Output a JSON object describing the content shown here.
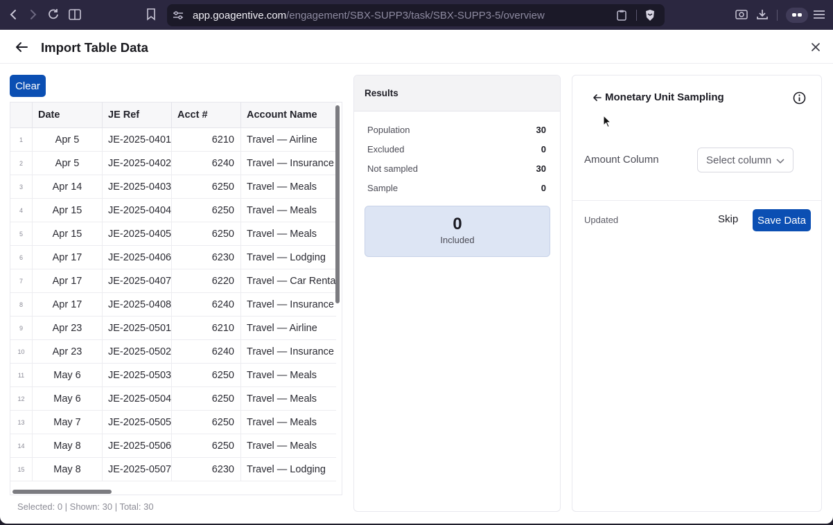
{
  "browser": {
    "url_host": "app.goagentive.com",
    "url_path": "/engagement/SBX-SUPP3/task/SBX-SUPP3-5/overview",
    "icons": [
      "back-icon",
      "forward-icon",
      "reload-icon",
      "sidebar-icon",
      "bookmark-icon",
      "site-settings-icon",
      "clipboard-icon",
      "brave-shield-icon",
      "screenshot-icon",
      "download-icon",
      "wallet-icon",
      "menu-icon"
    ]
  },
  "header": {
    "title": "Import Table Data"
  },
  "toolbar": {
    "clear_label": "Clear"
  },
  "table": {
    "columns": [
      "Date",
      "JE Ref",
      "Acct #",
      "Account Name"
    ],
    "rows": [
      {
        "n": "1",
        "date": "Apr 5",
        "ref": "JE-2025-0401",
        "acct": "6210",
        "name": "Travel — Airline"
      },
      {
        "n": "2",
        "date": "Apr 5",
        "ref": "JE-2025-0402",
        "acct": "6240",
        "name": "Travel — Insurance"
      },
      {
        "n": "3",
        "date": "Apr 14",
        "ref": "JE-2025-0403",
        "acct": "6250",
        "name": "Travel — Meals"
      },
      {
        "n": "4",
        "date": "Apr 15",
        "ref": "JE-2025-0404",
        "acct": "6250",
        "name": "Travel — Meals"
      },
      {
        "n": "5",
        "date": "Apr 15",
        "ref": "JE-2025-0405",
        "acct": "6250",
        "name": "Travel — Meals"
      },
      {
        "n": "6",
        "date": "Apr 17",
        "ref": "JE-2025-0406",
        "acct": "6230",
        "name": "Travel — Lodging"
      },
      {
        "n": "7",
        "date": "Apr 17",
        "ref": "JE-2025-0407",
        "acct": "6220",
        "name": "Travel — Car Rental"
      },
      {
        "n": "8",
        "date": "Apr 17",
        "ref": "JE-2025-0408",
        "acct": "6240",
        "name": "Travel — Insurance"
      },
      {
        "n": "9",
        "date": "Apr 23",
        "ref": "JE-2025-0501",
        "acct": "6210",
        "name": "Travel — Airline"
      },
      {
        "n": "10",
        "date": "Apr 23",
        "ref": "JE-2025-0502",
        "acct": "6240",
        "name": "Travel — Insurance"
      },
      {
        "n": "11",
        "date": "May 6",
        "ref": "JE-2025-0503",
        "acct": "6250",
        "name": "Travel — Meals"
      },
      {
        "n": "12",
        "date": "May 6",
        "ref": "JE-2025-0504",
        "acct": "6250",
        "name": "Travel — Meals"
      },
      {
        "n": "13",
        "date": "May 7",
        "ref": "JE-2025-0505",
        "acct": "6250",
        "name": "Travel — Meals"
      },
      {
        "n": "14",
        "date": "May 8",
        "ref": "JE-2025-0506",
        "acct": "6250",
        "name": "Travel — Meals"
      },
      {
        "n": "15",
        "date": "May 8",
        "ref": "JE-2025-0507",
        "acct": "6230",
        "name": "Travel — Lodging"
      }
    ],
    "status": "Selected: 0 | Shown: 30 | Total: 30"
  },
  "results": {
    "title": "Results",
    "stats": [
      {
        "label": "Population",
        "value": "30"
      },
      {
        "label": "Excluded",
        "value": "0"
      },
      {
        "label": "Not sampled",
        "value": "30"
      },
      {
        "label": "Sample",
        "value": "0"
      }
    ],
    "included_count": "0",
    "included_label": "Included"
  },
  "sampling": {
    "title": "Monetary Unit Sampling",
    "amount_label": "Amount Column",
    "select_placeholder": "Select column",
    "updated_label": "Updated",
    "skip_label": "Skip",
    "save_label": "Save Data"
  },
  "colors": {
    "accent": "#0b4fb3",
    "included_bg": "#dde5f4",
    "chrome_bg": "#2b2740"
  }
}
